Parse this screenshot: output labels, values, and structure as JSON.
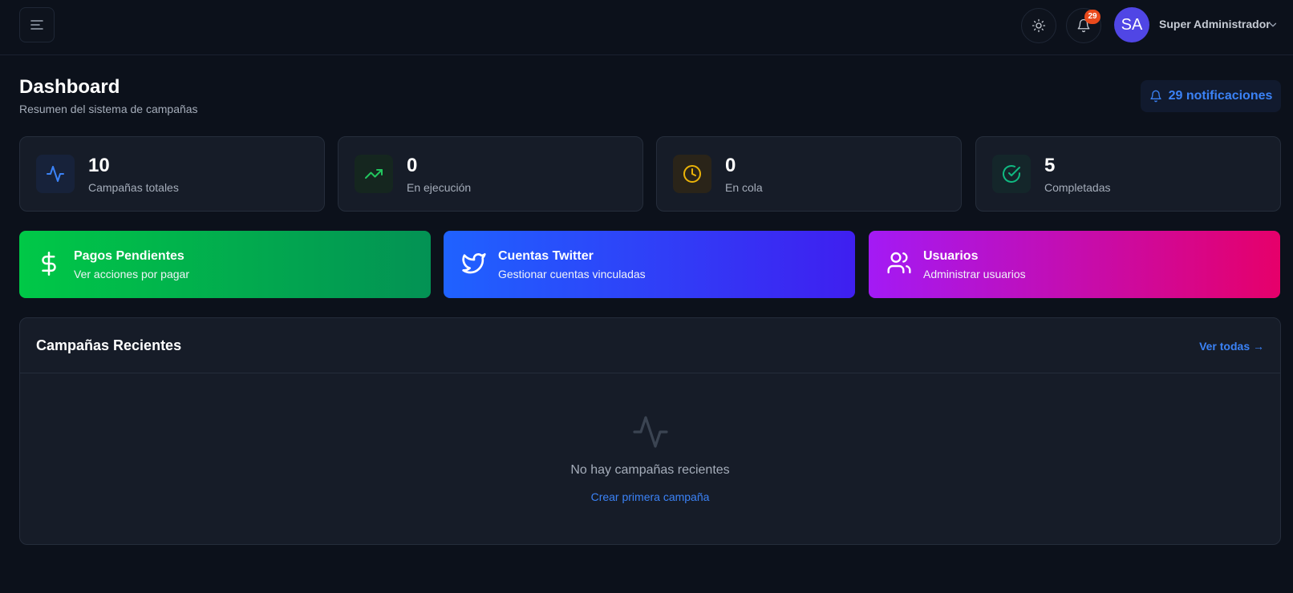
{
  "header": {
    "user_initials": "SA",
    "user_name": "Super Administrador",
    "notification_count": "29",
    "icons": [
      "menu-icon",
      "sun-icon",
      "bell-icon",
      "chevron-down-icon"
    ]
  },
  "page": {
    "title": "Dashboard",
    "subtitle": "Resumen del sistema de campañas",
    "notifications_button": "29 notificaciones"
  },
  "stats": [
    {
      "value": "10",
      "label": "Campañas totales",
      "icon": "activity-icon",
      "color": "#3b82f6"
    },
    {
      "value": "0",
      "label": "En ejecución",
      "icon": "trending-up-icon",
      "color": "#22c55e"
    },
    {
      "value": "0",
      "label": "En cola",
      "icon": "clock-icon",
      "color": "#eab308"
    },
    {
      "value": "5",
      "label": "Completadas",
      "icon": "check-circle-icon",
      "color": "#10b981"
    }
  ],
  "actions": [
    {
      "title": "Pagos Pendientes",
      "subtitle": "Ver acciones por pagar",
      "icon": "dollar-icon",
      "gradient": [
        "#00c847",
        "#039254"
      ]
    },
    {
      "title": "Cuentas Twitter",
      "subtitle": "Gestionar cuentas vinculadas",
      "icon": "twitter-icon",
      "gradient": [
        "#1f62ff",
        "#3f1ff0"
      ]
    },
    {
      "title": "Usuarios",
      "subtitle": "Administrar usuarios",
      "icon": "users-icon",
      "gradient": [
        "#a31af5",
        "#e6006a"
      ]
    }
  ],
  "recent": {
    "title": "Campañas Recientes",
    "view_all": "Ver todas →",
    "empty_text": "No hay campañas recientes",
    "create_cta": "Crear primera campaña"
  }
}
